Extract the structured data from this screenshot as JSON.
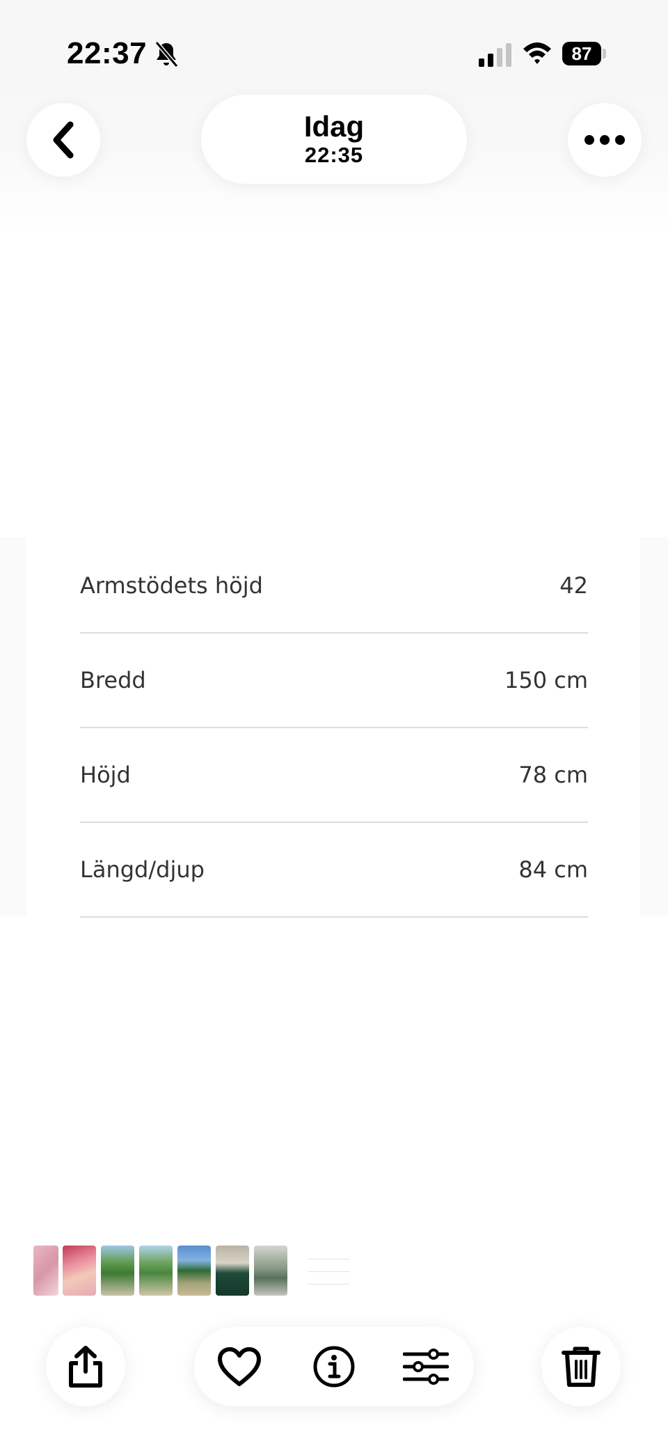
{
  "status_bar": {
    "time": "22:37",
    "battery": "87"
  },
  "header": {
    "title": "Idag",
    "time": "22:35"
  },
  "photo": {
    "rows": [
      {
        "label": "Armstödets höjd",
        "value": "42"
      },
      {
        "label": "Bredd",
        "value": "150 cm"
      },
      {
        "label": "Höjd",
        "value": "78 cm"
      },
      {
        "label": "Längd/djup",
        "value": "84 cm"
      }
    ]
  },
  "icons": {
    "back": "chevron-left-icon",
    "more": "ellipsis-icon",
    "share": "share-icon",
    "favorite": "heart-icon",
    "info": "info-icon",
    "adjust": "sliders-icon",
    "delete": "trash-icon"
  },
  "colors": {
    "background": "#ffffff",
    "icon": "#000000",
    "divider": "#dcdcdc"
  }
}
